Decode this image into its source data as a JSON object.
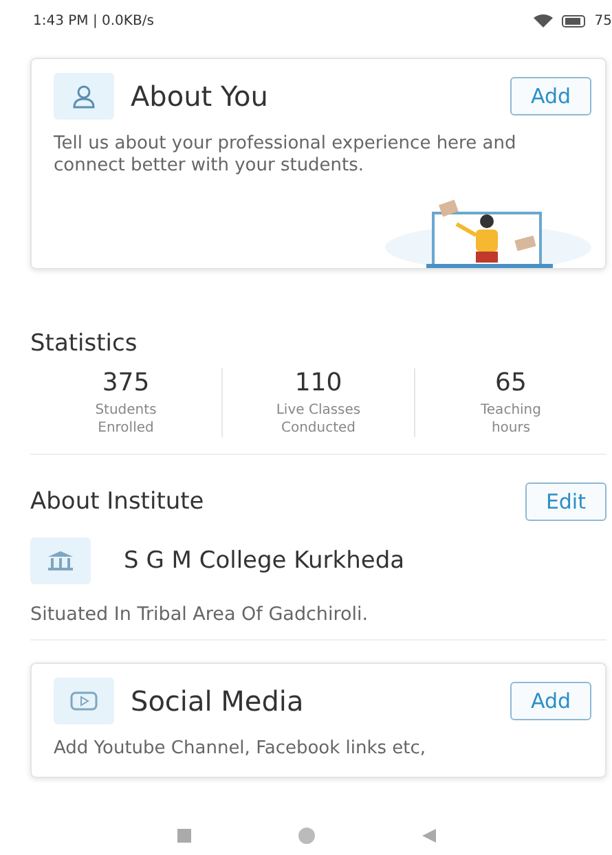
{
  "status_bar": {
    "time": "1:43 PM | 0.0KB/s",
    "battery": "75"
  },
  "about_you": {
    "title": "About You",
    "button": "Add",
    "description": "Tell us about your professional experience here and connect better with your students."
  },
  "statistics": {
    "title": "Statistics",
    "items": [
      {
        "value": "375",
        "label": "Students Enrolled"
      },
      {
        "value": "110",
        "label": "Live Classes Conducted"
      },
      {
        "value": "65",
        "label": "Teaching hours"
      }
    ]
  },
  "about_institute": {
    "title": "About Institute",
    "button": "Edit",
    "name": "S G M College Kurkheda",
    "description": "Situated In Tribal Area Of Gadchiroli."
  },
  "social_media": {
    "title": "Social Media",
    "button": "Add",
    "description": "Add Youtube Channel, Facebook links etc,"
  }
}
